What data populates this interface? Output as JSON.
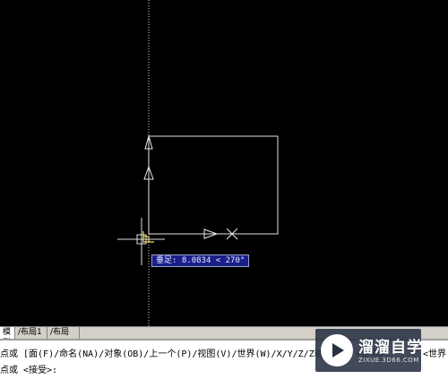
{
  "canvas": {
    "dynamic_input": {
      "label": "垂足",
      "value": "8.0834 < 270°"
    }
  },
  "layout_tabs": [
    {
      "label": "模型"
    },
    {
      "label": "布局1"
    },
    {
      "label": "布局2"
    }
  ],
  "command_area": {
    "line1": "点或 [面(F)/命名(NA)/对象(OB)/上一个(P)/视图(V)/世界(W)/X/Y/Z/Z轴(ZA)] <世界>:",
    "line1_tail": "<世界",
    "line2": "点或 <接受>:"
  },
  "watermark": {
    "title": "溜溜自学",
    "url": "ZIXUE.3D66.COM"
  }
}
